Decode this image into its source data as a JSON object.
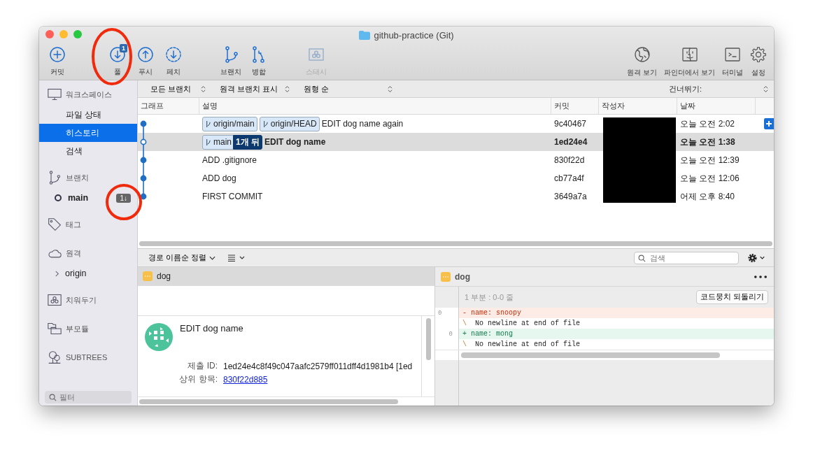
{
  "window": {
    "title": "github-practice (Git)"
  },
  "toolbar": {
    "groups": [
      [
        {
          "label": "커밋",
          "disabled": false
        }
      ],
      [
        {
          "label": "풀",
          "disabled": false,
          "badge": "1"
        },
        {
          "label": "푸시",
          "disabled": false
        },
        {
          "label": "페치",
          "disabled": false
        }
      ],
      [
        {
          "label": "브랜치",
          "disabled": false
        },
        {
          "label": "병합",
          "disabled": false
        }
      ],
      [
        {
          "label": "스태시",
          "disabled": true
        }
      ]
    ],
    "right": [
      {
        "label": "원격 보기"
      },
      {
        "label": "파인더에서 보기"
      },
      {
        "label": "터미널"
      },
      {
        "label": "설정"
      }
    ]
  },
  "sidebar": {
    "items": [
      {
        "kind": "header",
        "label": "워크스페이스"
      },
      {
        "kind": "item",
        "label": "파일 상태",
        "selected": false
      },
      {
        "kind": "item",
        "label": "히스토리",
        "selected": true
      },
      {
        "kind": "item",
        "label": "검색",
        "selected": false
      },
      {
        "kind": "header",
        "label": "브랜치"
      },
      {
        "kind": "branch",
        "label": "main",
        "badge": "1↓"
      },
      {
        "kind": "header",
        "label": "태그"
      },
      {
        "kind": "header",
        "label": "원격"
      },
      {
        "kind": "remote",
        "label": "origin",
        "expanded": false
      },
      {
        "kind": "header",
        "label": "치워두기"
      },
      {
        "kind": "header",
        "label": "부모듈"
      },
      {
        "kind": "header",
        "label": "SUBTREES"
      }
    ],
    "filter": {
      "placeholder": "필터"
    }
  },
  "filters": [
    "모든 브랜치",
    "원격 브랜치 표시",
    "원형 순"
  ],
  "skip_label": "건너뛰기:",
  "table": {
    "columns": [
      "그래프",
      "설명",
      "커밋",
      "작성자",
      "날짜"
    ],
    "rows": [
      {
        "refs": [
          {
            "label": "origin/main",
            "kind": "branch"
          },
          {
            "label": "origin/HEAD",
            "kind": "branch"
          }
        ],
        "message": "EDIT dog name again",
        "commit": "9c40467",
        "date": "오늘 오전 2:02",
        "selected": false,
        "head": false
      },
      {
        "refs": [
          {
            "label": "main",
            "kind": "branch"
          },
          {
            "label": "1개 뒤",
            "kind": "behind"
          }
        ],
        "message": "EDIT dog name",
        "commit": "1ed24e4",
        "date": "오늘 오전 1:38",
        "selected": true,
        "head": true
      },
      {
        "refs": [],
        "message": "ADD .gitignore",
        "commit": "830f22d",
        "date": "오늘 오전 12:39",
        "selected": false,
        "head": false
      },
      {
        "refs": [],
        "message": "ADD dog",
        "commit": "cb77a4f",
        "date": "오늘 오전 12:06",
        "selected": false,
        "head": false
      },
      {
        "refs": [],
        "message": "FIRST COMMIT",
        "commit": "3649a7a",
        "date": "어제 오후 8:40",
        "selected": false,
        "head": false
      }
    ]
  },
  "files_toolbar": {
    "sort": "경로 이름순 정렬",
    "search": {
      "placeholder": "검색"
    }
  },
  "files": [
    {
      "name": "dog",
      "selected": true
    }
  ],
  "details": {
    "title": "EDIT dog name",
    "fields": [
      {
        "label": "제출 ID:",
        "value": "1ed24e4c8f49c047aafc2579ff011dff4d1981b4 [1ed",
        "kind": "text"
      },
      {
        "label": "상위 항목:",
        "value": "830f22d885",
        "kind": "link"
      }
    ]
  },
  "diff": {
    "file": "dog",
    "hunk": "1 부분 : 0-0 줄",
    "revert": "코드뭉치 되돌리기",
    "lines": [
      {
        "kind": "removed",
        "old": "0",
        "sign": "-",
        "text": "name: snoopy"
      },
      {
        "kind": "note",
        "sign": "\\",
        "text": " No newline at end of file"
      },
      {
        "kind": "added",
        "new": "0",
        "sign": "+",
        "text": "name: mong"
      },
      {
        "kind": "note",
        "sign": "\\",
        "text": " No newline at end of file"
      }
    ]
  }
}
